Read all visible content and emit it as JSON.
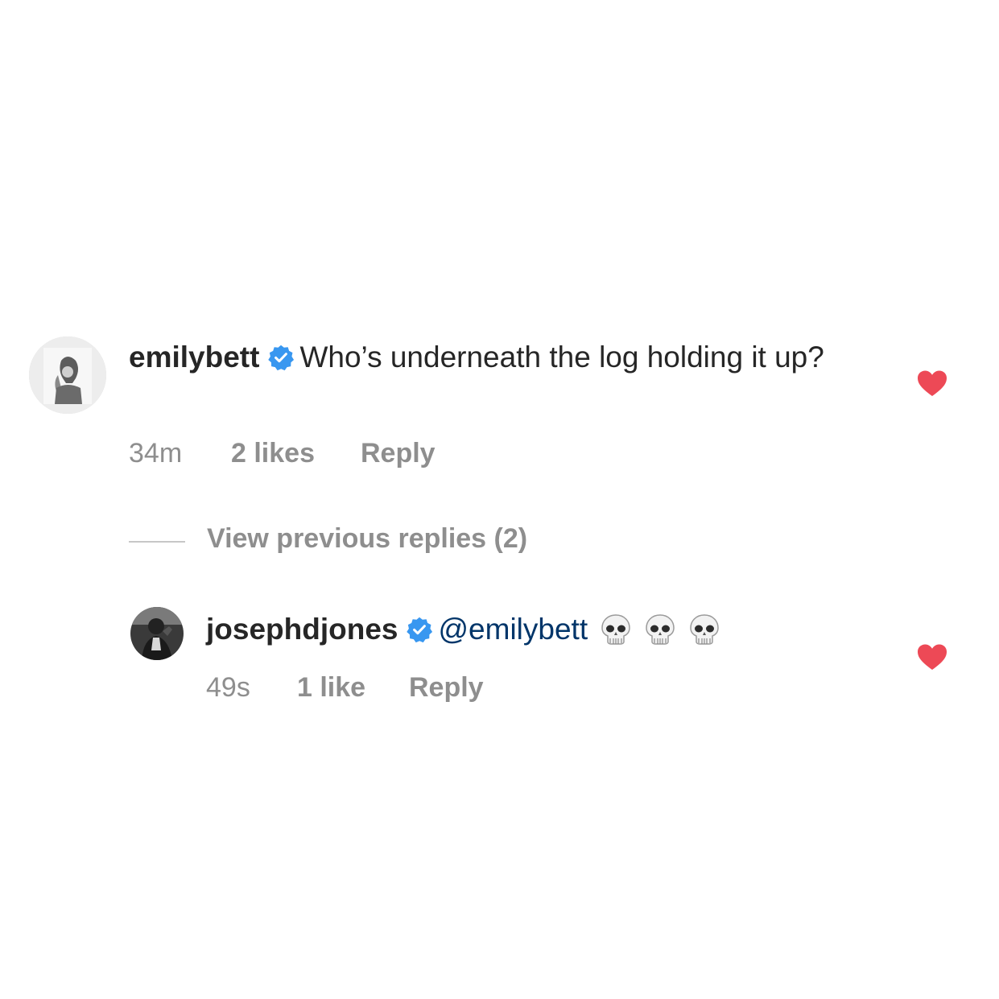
{
  "comments": [
    {
      "username": "emilybett",
      "verified": true,
      "text": "Who’s underneath the log holding it up?",
      "time": "34m",
      "likes": "2 likes",
      "reply_label": "Reply",
      "liked": true
    }
  ],
  "view_previous": {
    "label": "View previous replies (2)"
  },
  "replies": [
    {
      "username": "josephdjones",
      "verified": true,
      "mention": "@emilybett",
      "emojis": [
        "skull-emoji",
        "skull-emoji",
        "skull-emoji"
      ],
      "time": "49s",
      "likes": "1 like",
      "reply_label": "Reply",
      "liked": true
    }
  ],
  "colors": {
    "text": "#262626",
    "meta": "#8e8e8e",
    "mention": "#003569",
    "verified": "#3897f0",
    "heart": "#ed4956"
  }
}
